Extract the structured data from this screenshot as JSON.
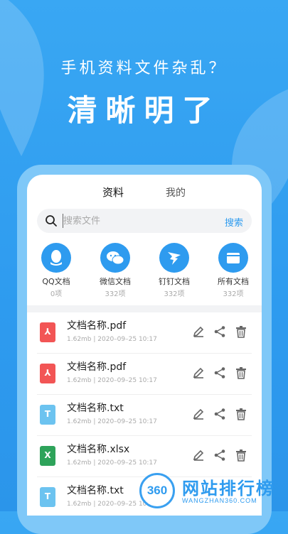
{
  "headline": {
    "sub": "手机资料文件杂乱？",
    "main": "清晰明了"
  },
  "tabs": [
    {
      "label": "资料",
      "active": true
    },
    {
      "label": "我的",
      "active": false
    }
  ],
  "search": {
    "placeholder": "搜索文件",
    "button_label": "搜索"
  },
  "categories": [
    {
      "label": "QQ文档",
      "count": "0项",
      "icon": "qq-icon"
    },
    {
      "label": "微信文档",
      "count": "332项",
      "icon": "wechat-icon"
    },
    {
      "label": "钉钉文档",
      "count": "332项",
      "icon": "dingtalk-icon"
    },
    {
      "label": "所有文档",
      "count": "332项",
      "icon": "folder-icon"
    }
  ],
  "files": [
    {
      "name": "文档名称.pdf",
      "meta": "1.62mb  |  2020–09–25 10:17",
      "type": "pdf",
      "color": "#f25555",
      "glyph": "⅄"
    },
    {
      "name": "文档名称.pdf",
      "meta": "1.62mb  |  2020–09–25 10:17",
      "type": "pdf",
      "color": "#f25555",
      "glyph": "⅄"
    },
    {
      "name": "文档名称.txt",
      "meta": "1.62mb  |  2020–09–25 10:17",
      "type": "txt",
      "color": "#6cc3f0",
      "glyph": "T"
    },
    {
      "name": "文档名称.xlsx",
      "meta": "1.62mb  |  2020–09–25 10:17",
      "type": "xlsx",
      "color": "#2ea35a",
      "glyph": "X"
    },
    {
      "name": "文档名称.txt",
      "meta": "1.62mb  |  2020–09–25 10:17",
      "type": "txt",
      "color": "#6cc3f0",
      "glyph": "T"
    }
  ],
  "watermark": {
    "number": "360",
    "text": "网站排行榜",
    "sub": "WANGZHAN360.COM"
  },
  "colors": {
    "accent": "#2e9bef",
    "background": "#39a7f3"
  }
}
